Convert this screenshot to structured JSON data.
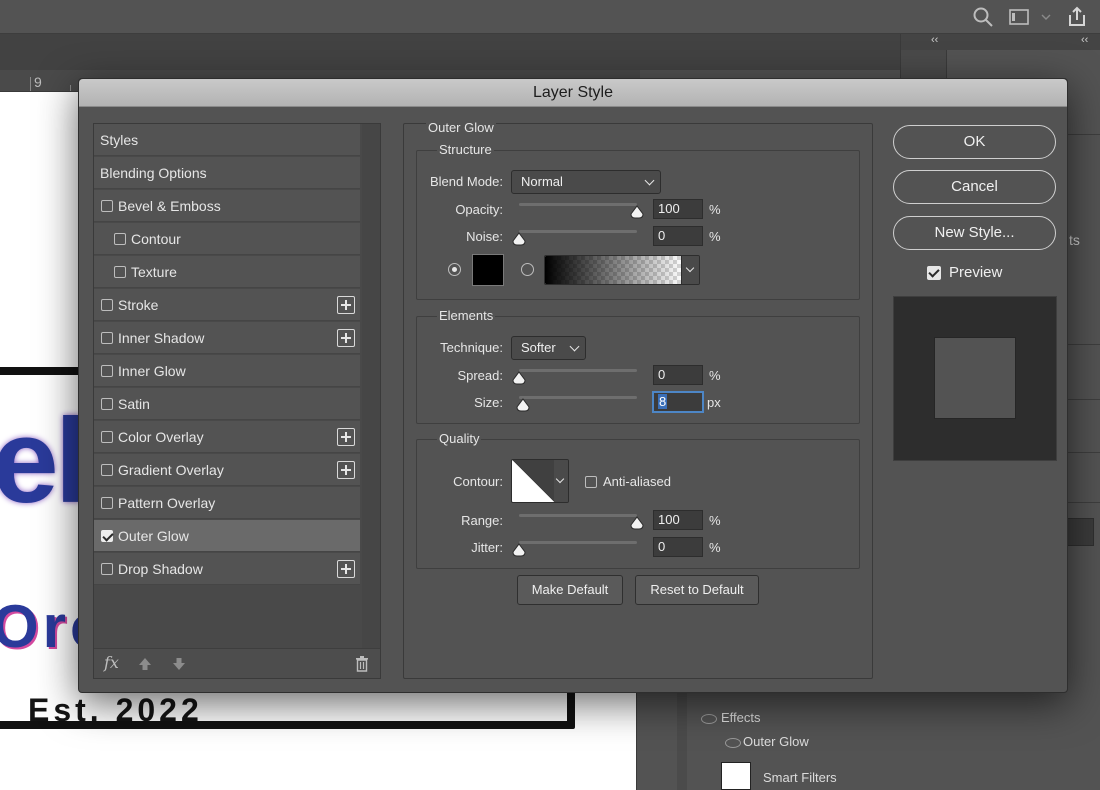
{
  "dialog": {
    "title": "Layer Style"
  },
  "styles": {
    "items": [
      {
        "label": "Styles",
        "type": "header",
        "checkbox": false,
        "checked": false,
        "plus": false,
        "selected": false
      },
      {
        "label": "Blending Options",
        "type": "header",
        "checkbox": false,
        "checked": false,
        "plus": false,
        "selected": false
      },
      {
        "label": "Bevel & Emboss",
        "type": "item",
        "checkbox": true,
        "checked": false,
        "plus": false,
        "selected": false
      },
      {
        "label": "Contour",
        "type": "indent",
        "checkbox": true,
        "checked": false,
        "plus": false,
        "selected": false
      },
      {
        "label": "Texture",
        "type": "indent",
        "checkbox": true,
        "checked": false,
        "plus": false,
        "selected": false
      },
      {
        "label": "Stroke",
        "type": "item",
        "checkbox": true,
        "checked": false,
        "plus": true,
        "selected": false
      },
      {
        "label": "Inner Shadow",
        "type": "item",
        "checkbox": true,
        "checked": false,
        "plus": true,
        "selected": false
      },
      {
        "label": "Inner Glow",
        "type": "item",
        "checkbox": true,
        "checked": false,
        "plus": false,
        "selected": false
      },
      {
        "label": "Satin",
        "type": "item",
        "checkbox": true,
        "checked": false,
        "plus": false,
        "selected": false
      },
      {
        "label": "Color Overlay",
        "type": "item",
        "checkbox": true,
        "checked": false,
        "plus": true,
        "selected": false
      },
      {
        "label": "Gradient Overlay",
        "type": "item",
        "checkbox": true,
        "checked": false,
        "plus": true,
        "selected": false
      },
      {
        "label": "Pattern Overlay",
        "type": "item",
        "checkbox": true,
        "checked": false,
        "plus": false,
        "selected": false
      },
      {
        "label": "Outer Glow",
        "type": "item",
        "checkbox": true,
        "checked": true,
        "plus": false,
        "selected": true
      },
      {
        "label": "Drop Shadow",
        "type": "item",
        "checkbox": true,
        "checked": false,
        "plus": true,
        "selected": false
      }
    ],
    "footer": {
      "fx_label": "fx"
    }
  },
  "outer_glow": {
    "title": "Outer Glow",
    "structure": {
      "title": "Structure",
      "blend_mode_label": "Blend Mode:",
      "blend_mode_value": "Normal",
      "opacity_label": "Opacity:",
      "opacity_value": "100",
      "opacity_level": 1.0,
      "opacity_unit": "%",
      "noise_label": "Noise:",
      "noise_value": "0",
      "noise_level": 0.0,
      "noise_unit": "%",
      "fill_mode": "color",
      "swatch_color": "#000000"
    },
    "elements": {
      "title": "Elements",
      "technique_label": "Technique:",
      "technique_value": "Softer",
      "spread_label": "Spread:",
      "spread_value": "0",
      "spread_level": 0.0,
      "spread_unit": "%",
      "size_label": "Size:",
      "size_value": "8",
      "size_level": 0.03,
      "size_unit": "px"
    },
    "quality": {
      "title": "Quality",
      "contour_label": "Contour:",
      "anti_aliased_label": "Anti-aliased",
      "anti_aliased_checked": false,
      "range_label": "Range:",
      "range_value": "100",
      "range_level": 1.0,
      "range_unit": "%",
      "jitter_label": "Jitter:",
      "jitter_value": "0",
      "jitter_level": 0.0,
      "jitter_unit": "%"
    },
    "make_default_label": "Make Default",
    "reset_default_label": "Reset to Default"
  },
  "actions": {
    "ok_label": "OK",
    "cancel_label": "Cancel",
    "new_style_label": "New Style...",
    "preview_label": "Preview",
    "preview_checked": true
  },
  "background": {
    "ruler_number": "9",
    "logo_partial_1": "elo",
    "logo_partial_2": "Oro",
    "logo_est": "Est. 2022",
    "dock_partial_text": "ts",
    "layers": {
      "effects_label": "Effects",
      "outer_glow_label": "Outer Glow",
      "smart_filters_label": "Smart Filters"
    }
  },
  "colors": {
    "accent_focus": "#4d86c6",
    "logo_blue": "#2a3a9a",
    "logo_pink": "#d44aa0"
  }
}
